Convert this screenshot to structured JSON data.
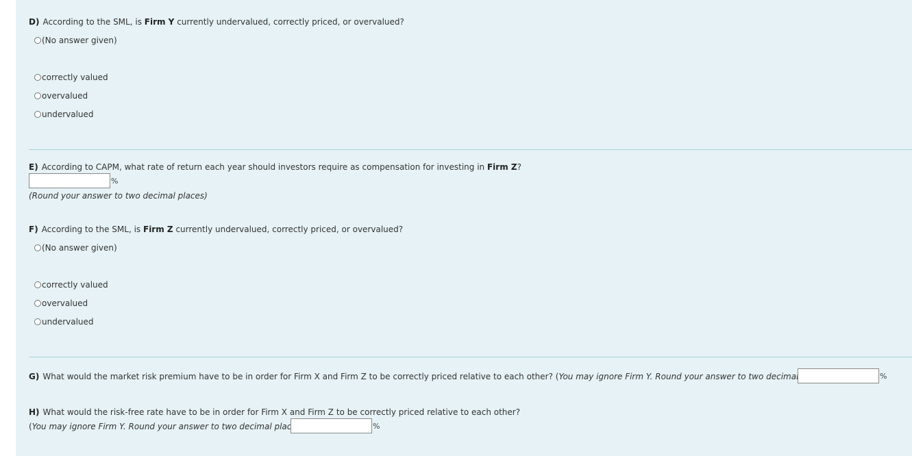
{
  "questions": {
    "D": {
      "letter": "D)",
      "text_before": "According to the SML, is ",
      "bold": "Firm Y",
      "text_after": " currently undervalued, correctly priced, or overvalued?",
      "options": [
        "(No answer given)",
        "correctly valued",
        "overvalued",
        "undervalued"
      ]
    },
    "E": {
      "letter": "E)",
      "text_before": "According to CAPM, what rate of return each year should investors require as compensation for investing in ",
      "bold": "Firm Z",
      "text_after": "?",
      "input_value": "",
      "unit": "%",
      "hint": "(Round your answer to two decimal places)"
    },
    "F": {
      "letter": "F)",
      "text_before": "According to the SML, is ",
      "bold": "Firm Z",
      "text_after": " currently undervalued, correctly priced, or overvalued?",
      "options": [
        "(No answer given)",
        "correctly valued",
        "overvalued",
        "undervalued"
      ]
    },
    "G": {
      "letter": "G)",
      "text": "What would the market risk premium have to be in order for Firm X and Firm Z to be correctly priced relative to each other? (",
      "hint_italic": "You may ignore Firm Y. Round your answer to two decimal places",
      "text_close": ")",
      "input_value": "",
      "unit": "%"
    },
    "H": {
      "letter": "H)",
      "text": "What would the risk-free rate have to be in order for Firm X and Firm Z to be correctly priced relative to each other?",
      "hint_open": "(",
      "hint_italic": "You may ignore Firm Y. Round your answer to two decimal places",
      "hint_close": ")",
      "input_value": "",
      "unit": "%"
    }
  }
}
